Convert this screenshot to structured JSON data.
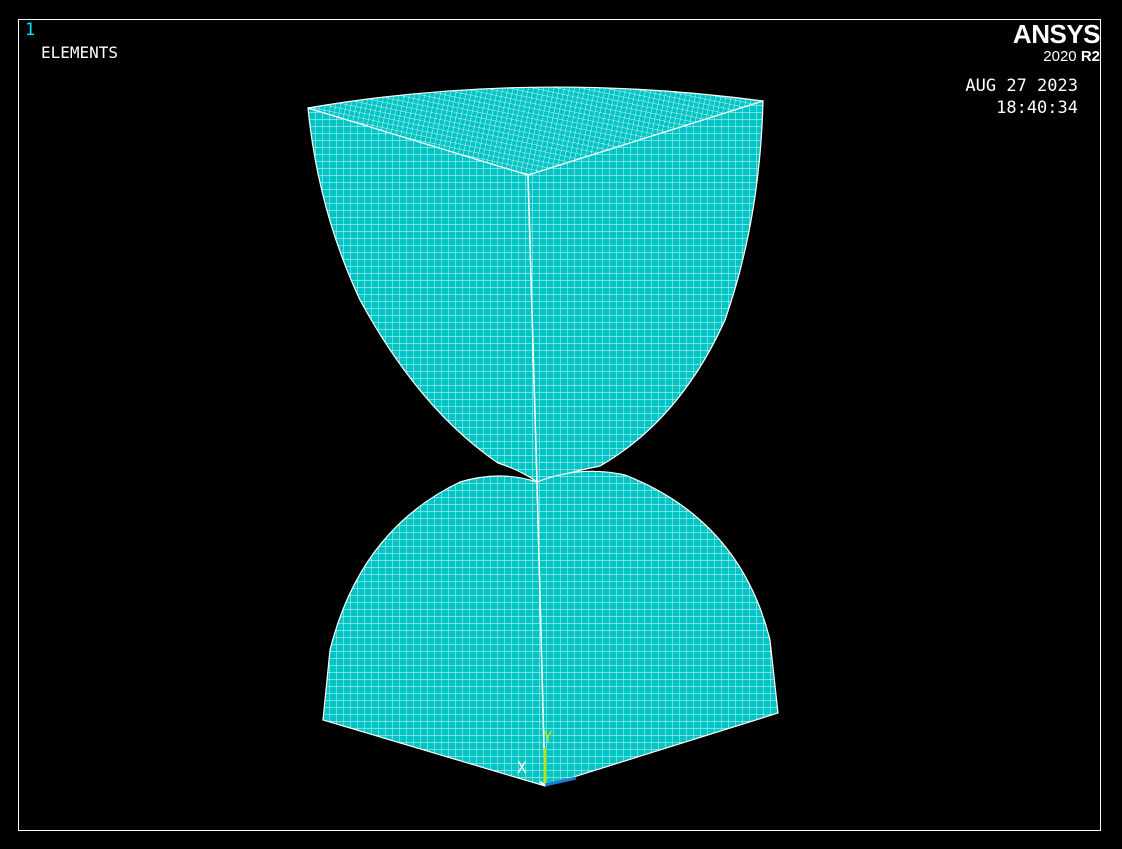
{
  "window": {
    "number": "1",
    "plot_label": "ELEMENTS"
  },
  "brand": {
    "name": "ANSYS",
    "version_year": "2020",
    "version_release": "R2"
  },
  "timestamp": {
    "date": "AUG 27 2023",
    "time": "18:40:34"
  },
  "triad": {
    "x_label": "X",
    "y_label": "Y"
  },
  "colors": {
    "background": "#000000",
    "mesh_fill": "#00c5c5",
    "mesh_lines": "#ffffff",
    "window_number": "#00e5ff",
    "y_axis": "#b5e61d",
    "z_axis": "#1e7bd8"
  }
}
